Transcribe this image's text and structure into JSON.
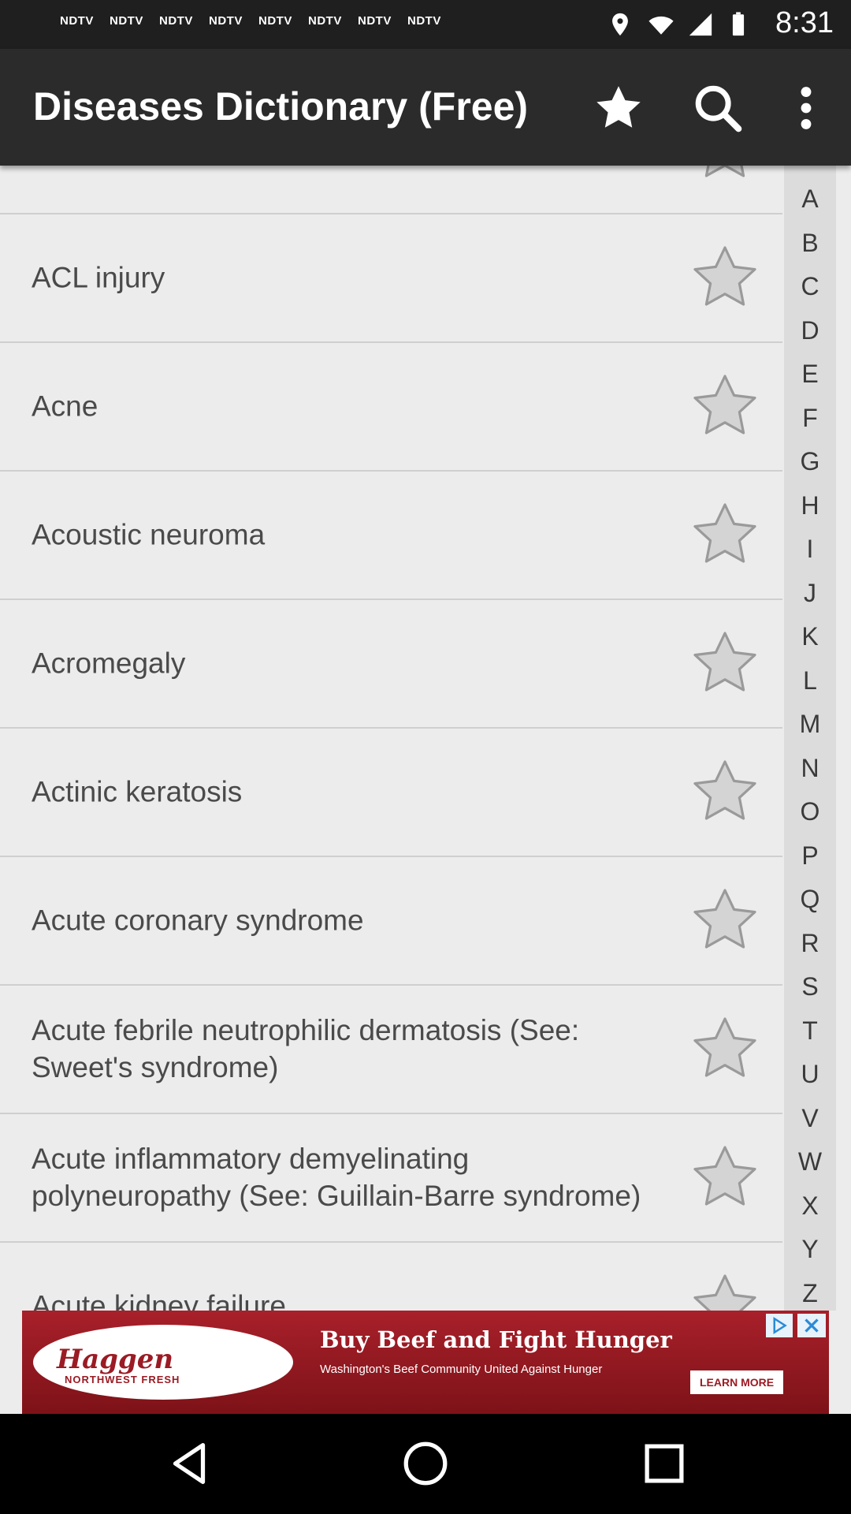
{
  "status_bar": {
    "notifications": [
      "NDTV",
      "NDTV",
      "NDTV",
      "NDTV",
      "NDTV",
      "NDTV",
      "NDTV",
      "NDTV"
    ],
    "time": "8:31"
  },
  "app_bar": {
    "title": "Diseases Dictionary (Free)",
    "icons": [
      "favorites-star-icon",
      "search-icon",
      "overflow-menu-icon"
    ]
  },
  "diseases": [
    {
      "name": ""
    },
    {
      "name": "ACL injury"
    },
    {
      "name": "Acne"
    },
    {
      "name": "Acoustic neuroma"
    },
    {
      "name": "Acromegaly"
    },
    {
      "name": "Actinic keratosis"
    },
    {
      "name": "Acute coronary syndrome"
    },
    {
      "name": "Acute febrile neutrophilic dermatosis (See: Sweet's syndrome)"
    },
    {
      "name": "Acute inflammatory demyelinating polyneuropathy (See: Guillain-Barre syndrome)"
    },
    {
      "name": "Acute kidney failure"
    }
  ],
  "alphabet_index": [
    "A",
    "B",
    "C",
    "D",
    "E",
    "F",
    "G",
    "H",
    "I",
    "J",
    "K",
    "L",
    "M",
    "N",
    "O",
    "P",
    "Q",
    "R",
    "S",
    "T",
    "U",
    "V",
    "W",
    "X",
    "Y",
    "Z"
  ],
  "ad": {
    "brand": "Haggen",
    "brand_sub": "NORTHWEST FRESH",
    "headline": "Buy Beef and Fight Hunger",
    "subtext": "Washington's Beef Community United Against Hunger",
    "cta": "LEARN MORE"
  },
  "colors": {
    "app_bar": "#2b2b2b",
    "list_background": "#ececec",
    "index_background": "#dcdcdc",
    "star": "#d4d4d4",
    "ad_background": "#a8202a"
  }
}
